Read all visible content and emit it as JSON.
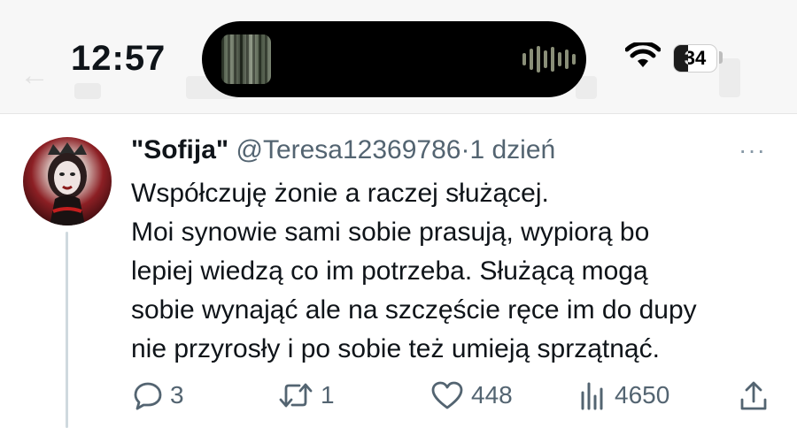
{
  "status_bar": {
    "time": "12:57",
    "battery": "34",
    "battery_level": 0.34
  },
  "tweet": {
    "display_name": "\"Sofija\"",
    "handle": "@Teresa12369786",
    "separator": "·",
    "time": "1 dzień",
    "more": "···",
    "lines": [
      "Współczuję żonie a raczej służącej.",
      "Moi synowie sami sobie prasują, wypiorą bo",
      "lepiej wiedzą co im potrzeba. Służącą mogą",
      "sobie wynająć ale na szczęście ręce im do dupy",
      "nie przyrosły i po sobie też umieją sprzątnąć."
    ],
    "actions": {
      "replies": "3",
      "retweets": "1",
      "likes": "448",
      "views": "4650"
    }
  },
  "icons": {
    "reply": "reply-icon",
    "retweet": "retweet-icon",
    "like": "heart-icon",
    "views": "views-icon",
    "share": "share-icon",
    "wifi": "wifi-icon",
    "battery": "battery-icon"
  }
}
